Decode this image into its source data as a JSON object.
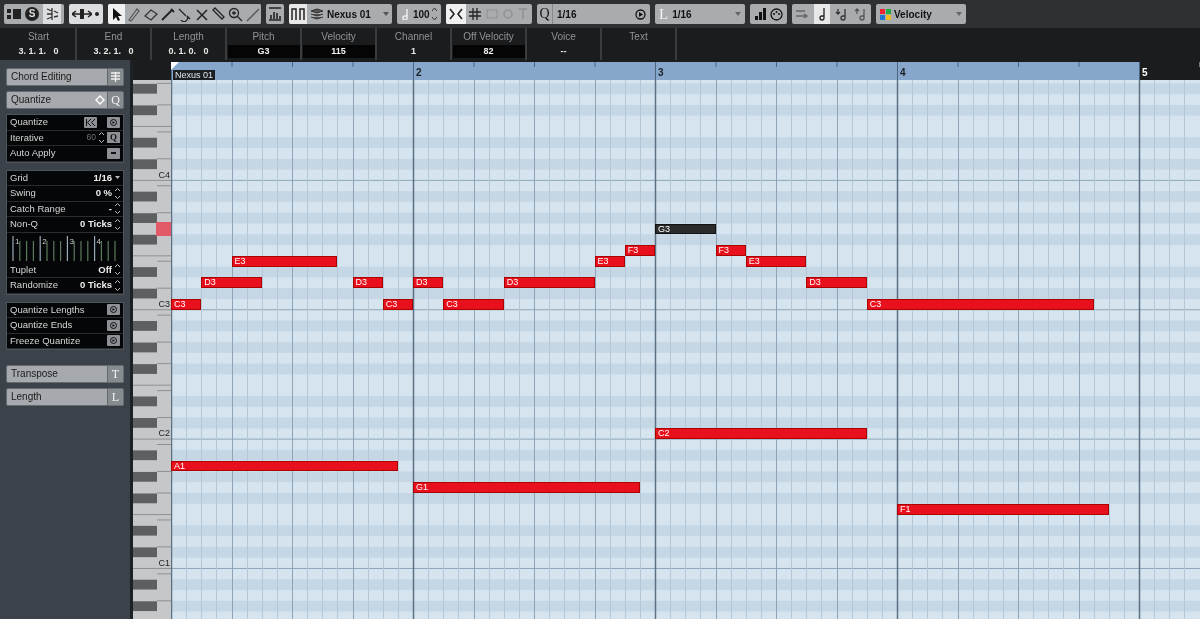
{
  "toolbar": {
    "solo_button": "S",
    "tools": [
      {
        "kind": "arrow",
        "selected": true
      },
      {
        "kind": "pencil",
        "selected": false
      },
      {
        "kind": "eraser",
        "selected": false
      },
      {
        "kind": "knife",
        "selected": false
      },
      {
        "kind": "glue",
        "selected": false
      },
      {
        "kind": "mute",
        "selected": false
      },
      {
        "kind": "trim",
        "selected": false
      },
      {
        "kind": "zoom",
        "selected": false
      },
      {
        "kind": "line",
        "selected": false
      }
    ],
    "part_selector": "Nexus 01",
    "insert_velocity": "100",
    "quantize_label": "Q",
    "quantize_value": "1/16",
    "length_label": "L",
    "length_value": "1/16",
    "lane_selector": "Velocity"
  },
  "info_line": [
    {
      "label": "Start",
      "value": "3. 1. 1.   0",
      "boxed": false
    },
    {
      "label": "End",
      "value": "3. 2. 1.   0",
      "boxed": false
    },
    {
      "label": "Length",
      "value": "0. 1. 0.   0",
      "boxed": false
    },
    {
      "label": "Pitch",
      "value": "G3",
      "boxed": true
    },
    {
      "label": "Velocity",
      "value": "115",
      "boxed": true
    },
    {
      "label": "Channel",
      "value": "1",
      "boxed": false
    },
    {
      "label": "Off Velocity",
      "value": "82",
      "boxed": true
    },
    {
      "label": "Voice",
      "value": "--",
      "boxed": false
    },
    {
      "label": "Text"
    }
  ],
  "inspector": {
    "sections": [
      {
        "title": "Chord Editing",
        "kind": "chord"
      },
      {
        "title": "Quantize",
        "kind": "quantize",
        "shortcut": "Q",
        "groups": [
          [
            {
              "kind": "quantize",
              "label": "Quantize"
            },
            {
              "kind": "iterative",
              "label": "Iterative",
              "value": "60",
              "button": "Q"
            },
            {
              "kind": "toggle",
              "label": "Auto Apply"
            }
          ],
          [
            {
              "kind": "dropdown",
              "label": "Grid",
              "value": "1/16"
            },
            {
              "kind": "spinner",
              "label": "Swing",
              "value": "0 %"
            },
            {
              "kind": "spinner",
              "label": "Catch Range",
              "value": "-"
            },
            {
              "kind": "spinner",
              "label": "Non-Q",
              "value": "0 Ticks"
            },
            {
              "kind": "grid",
              "beats": [
                "1",
                "2",
                "3",
                "4"
              ]
            },
            {
              "kind": "spinner",
              "label": "Tuplet",
              "value": "Off"
            },
            {
              "kind": "spinner",
              "label": "Randomize",
              "value": "0 Ticks"
            }
          ],
          [
            {
              "kind": "apply",
              "label": "Quantize Lengths"
            },
            {
              "kind": "apply",
              "label": "Quantize Ends"
            },
            {
              "kind": "apply",
              "label": "Freeze Quantize"
            }
          ]
        ]
      },
      {
        "title": "Transpose",
        "kind": "plain",
        "shortcut": "T"
      },
      {
        "title": "Length",
        "kind": "plain",
        "shortcut": "L"
      }
    ]
  },
  "ruler": {
    "part_name": "Nexus 01",
    "bars": [
      "2",
      "3",
      "4",
      "5"
    ]
  },
  "keyboard": {
    "labels": [
      "C4",
      "C3",
      "C2",
      "C1"
    ]
  },
  "notes": [
    {
      "label": "C3",
      "selected": false
    },
    {
      "label": "D3",
      "selected": false
    },
    {
      "label": "E3",
      "selected": false
    },
    {
      "label": "D3",
      "selected": false
    },
    {
      "label": "C3",
      "selected": false
    },
    {
      "label": "D3",
      "selected": false
    },
    {
      "label": "C3",
      "selected": false
    },
    {
      "label": "D3",
      "selected": false
    },
    {
      "label": "E3",
      "selected": false
    },
    {
      "label": "F3",
      "selected": false
    },
    {
      "label": "G3",
      "selected": true
    },
    {
      "label": "F3",
      "selected": false
    },
    {
      "label": "E3",
      "selected": false
    },
    {
      "label": "D3",
      "selected": false
    },
    {
      "label": "C3",
      "selected": false
    },
    {
      "label": "C2",
      "selected": false
    },
    {
      "label": "A1",
      "selected": false
    },
    {
      "label": "G1",
      "selected": false
    },
    {
      "label": "F1",
      "selected": false
    }
  ]
}
